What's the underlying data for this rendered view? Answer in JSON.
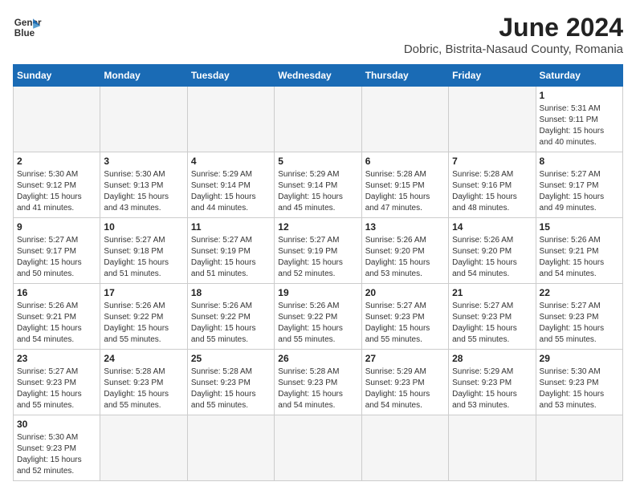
{
  "header": {
    "logo_line1": "General",
    "logo_line2": "Blue",
    "month_year": "June 2024",
    "location": "Dobric, Bistrita-Nasaud County, Romania"
  },
  "weekdays": [
    "Sunday",
    "Monday",
    "Tuesday",
    "Wednesday",
    "Thursday",
    "Friday",
    "Saturday"
  ],
  "weeks": [
    [
      {
        "day": "",
        "info": ""
      },
      {
        "day": "",
        "info": ""
      },
      {
        "day": "",
        "info": ""
      },
      {
        "day": "",
        "info": ""
      },
      {
        "day": "",
        "info": ""
      },
      {
        "day": "",
        "info": ""
      },
      {
        "day": "1",
        "info": "Sunrise: 5:31 AM\nSunset: 9:11 PM\nDaylight: 15 hours\nand 40 minutes."
      }
    ],
    [
      {
        "day": "2",
        "info": "Sunrise: 5:30 AM\nSunset: 9:12 PM\nDaylight: 15 hours\nand 41 minutes."
      },
      {
        "day": "3",
        "info": "Sunrise: 5:30 AM\nSunset: 9:13 PM\nDaylight: 15 hours\nand 43 minutes."
      },
      {
        "day": "4",
        "info": "Sunrise: 5:29 AM\nSunset: 9:14 PM\nDaylight: 15 hours\nand 44 minutes."
      },
      {
        "day": "5",
        "info": "Sunrise: 5:29 AM\nSunset: 9:14 PM\nDaylight: 15 hours\nand 45 minutes."
      },
      {
        "day": "6",
        "info": "Sunrise: 5:28 AM\nSunset: 9:15 PM\nDaylight: 15 hours\nand 47 minutes."
      },
      {
        "day": "7",
        "info": "Sunrise: 5:28 AM\nSunset: 9:16 PM\nDaylight: 15 hours\nand 48 minutes."
      },
      {
        "day": "8",
        "info": "Sunrise: 5:27 AM\nSunset: 9:17 PM\nDaylight: 15 hours\nand 49 minutes."
      }
    ],
    [
      {
        "day": "9",
        "info": "Sunrise: 5:27 AM\nSunset: 9:17 PM\nDaylight: 15 hours\nand 50 minutes."
      },
      {
        "day": "10",
        "info": "Sunrise: 5:27 AM\nSunset: 9:18 PM\nDaylight: 15 hours\nand 51 minutes."
      },
      {
        "day": "11",
        "info": "Sunrise: 5:27 AM\nSunset: 9:19 PM\nDaylight: 15 hours\nand 51 minutes."
      },
      {
        "day": "12",
        "info": "Sunrise: 5:27 AM\nSunset: 9:19 PM\nDaylight: 15 hours\nand 52 minutes."
      },
      {
        "day": "13",
        "info": "Sunrise: 5:26 AM\nSunset: 9:20 PM\nDaylight: 15 hours\nand 53 minutes."
      },
      {
        "day": "14",
        "info": "Sunrise: 5:26 AM\nSunset: 9:20 PM\nDaylight: 15 hours\nand 54 minutes."
      },
      {
        "day": "15",
        "info": "Sunrise: 5:26 AM\nSunset: 9:21 PM\nDaylight: 15 hours\nand 54 minutes."
      }
    ],
    [
      {
        "day": "16",
        "info": "Sunrise: 5:26 AM\nSunset: 9:21 PM\nDaylight: 15 hours\nand 54 minutes."
      },
      {
        "day": "17",
        "info": "Sunrise: 5:26 AM\nSunset: 9:22 PM\nDaylight: 15 hours\nand 55 minutes."
      },
      {
        "day": "18",
        "info": "Sunrise: 5:26 AM\nSunset: 9:22 PM\nDaylight: 15 hours\nand 55 minutes."
      },
      {
        "day": "19",
        "info": "Sunrise: 5:26 AM\nSunset: 9:22 PM\nDaylight: 15 hours\nand 55 minutes."
      },
      {
        "day": "20",
        "info": "Sunrise: 5:27 AM\nSunset: 9:23 PM\nDaylight: 15 hours\nand 55 minutes."
      },
      {
        "day": "21",
        "info": "Sunrise: 5:27 AM\nSunset: 9:23 PM\nDaylight: 15 hours\nand 55 minutes."
      },
      {
        "day": "22",
        "info": "Sunrise: 5:27 AM\nSunset: 9:23 PM\nDaylight: 15 hours\nand 55 minutes."
      }
    ],
    [
      {
        "day": "23",
        "info": "Sunrise: 5:27 AM\nSunset: 9:23 PM\nDaylight: 15 hours\nand 55 minutes."
      },
      {
        "day": "24",
        "info": "Sunrise: 5:28 AM\nSunset: 9:23 PM\nDaylight: 15 hours\nand 55 minutes."
      },
      {
        "day": "25",
        "info": "Sunrise: 5:28 AM\nSunset: 9:23 PM\nDaylight: 15 hours\nand 55 minutes."
      },
      {
        "day": "26",
        "info": "Sunrise: 5:28 AM\nSunset: 9:23 PM\nDaylight: 15 hours\nand 54 minutes."
      },
      {
        "day": "27",
        "info": "Sunrise: 5:29 AM\nSunset: 9:23 PM\nDaylight: 15 hours\nand 54 minutes."
      },
      {
        "day": "28",
        "info": "Sunrise: 5:29 AM\nSunset: 9:23 PM\nDaylight: 15 hours\nand 53 minutes."
      },
      {
        "day": "29",
        "info": "Sunrise: 5:30 AM\nSunset: 9:23 PM\nDaylight: 15 hours\nand 53 minutes."
      }
    ],
    [
      {
        "day": "30",
        "info": "Sunrise: 5:30 AM\nSunset: 9:23 PM\nDaylight: 15 hours\nand 52 minutes."
      },
      {
        "day": "",
        "info": ""
      },
      {
        "day": "",
        "info": ""
      },
      {
        "day": "",
        "info": ""
      },
      {
        "day": "",
        "info": ""
      },
      {
        "day": "",
        "info": ""
      },
      {
        "day": "",
        "info": ""
      }
    ]
  ]
}
